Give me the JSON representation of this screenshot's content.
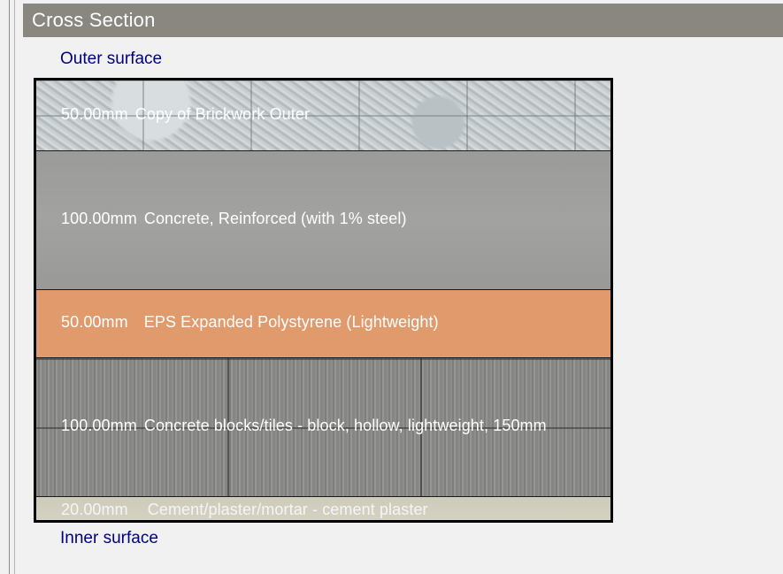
{
  "header": {
    "title": "Cross Section"
  },
  "labels": {
    "outer_surface": "Outer surface",
    "inner_surface": "Inner surface"
  },
  "layers": [
    {
      "thickness": "50.00mm",
      "material": "Copy of Brickwork Outer",
      "color": "#c4cbcd"
    },
    {
      "thickness": "100.00mm",
      "material": "Concrete, Reinforced (with 1% steel)",
      "color": "#9e9e9c"
    },
    {
      "thickness": "50.00mm",
      "material": "EPS Expanded Polystyrene (Lightweight)",
      "color": "#e19a6c"
    },
    {
      "thickness": "100.00mm",
      "material": "Concrete blocks/tiles - block, hollow, lightweight, 150mm",
      "color": "#8a8b88"
    },
    {
      "thickness": "20.00mm",
      "material": "Cement/plaster/mortar - cement plaster",
      "color": "#d2cebf"
    }
  ]
}
